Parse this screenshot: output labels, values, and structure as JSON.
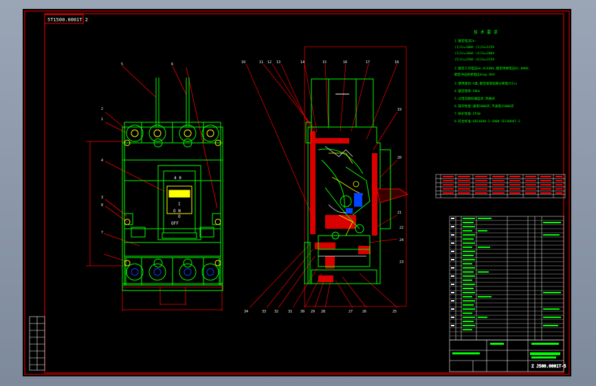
{
  "sheet": {
    "code_box": "5T1500.0001T 2",
    "title_block_code": "Z J500.0001T-5",
    "breaker": {
      "rating": "4 0",
      "on_label": "O N",
      "i_mark": "I",
      "o_mark": "O",
      "off_label": "OFF"
    },
    "notes": {
      "heading": "技 术 要 求",
      "lines": [
        "1.额定电流In:",
        "   (1)In=100A (2)In=125A",
        "   (3)In=160A (4)In=200A",
        "   (5)In=250A (6)In=315A",
        "2.额定工作电压Ue:AC400V,额定绝缘电压Ui:800V,",
        "  额定冲击耐受电压Uimp:8kV",
        "3.使用类别:A类,额定极限短路分断能力Icu",
        "4.额定频率:50Hz",
        "5.过电流脱扣器型式:热磁式",
        "6.操作性能:通电5000次,不通电15000次",
        "7.防护等级:IP30",
        "8.符合标准:GB14048.2-2008 IEC60947-2"
      ]
    },
    "top_labels": [
      "5",
      "6"
    ],
    "left_labels": [
      "2",
      "1",
      "4",
      "3",
      "8",
      "7"
    ],
    "section_top_labels": [
      "10",
      "11",
      "12",
      "13",
      "14",
      "15",
      "16",
      "17",
      "18"
    ],
    "section_bottom_labels": [
      "34",
      "33",
      "32",
      "31",
      "30",
      "29",
      "28",
      "27",
      "26",
      "25",
      "24",
      "23",
      "22"
    ],
    "section_right_labels": [
      "19",
      "20",
      "21"
    ]
  }
}
